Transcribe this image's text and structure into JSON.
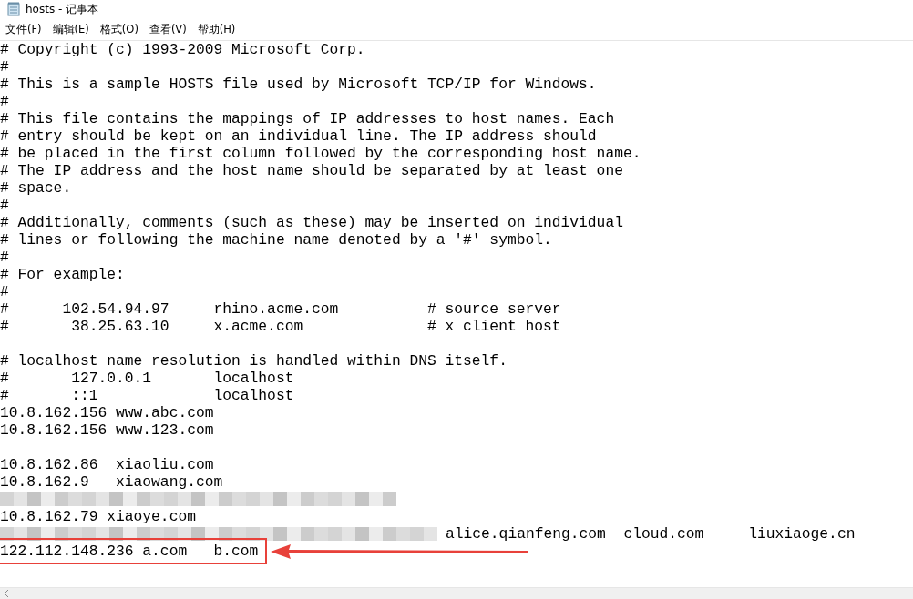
{
  "window": {
    "title": "hosts - 记事本"
  },
  "menu": [
    "文件(F)",
    "编辑(E)",
    "格式(O)",
    "查看(V)",
    "帮助(H)"
  ],
  "lines": [
    {
      "kind": "text",
      "text": "# Copyright (c) 1993-2009 Microsoft Corp."
    },
    {
      "kind": "text",
      "text": "#"
    },
    {
      "kind": "text",
      "text": "# This is a sample HOSTS file used by Microsoft TCP/IP for Windows."
    },
    {
      "kind": "text",
      "text": "#"
    },
    {
      "kind": "text",
      "text": "# This file contains the mappings of IP addresses to host names. Each"
    },
    {
      "kind": "text",
      "text": "# entry should be kept on an individual line. The IP address should"
    },
    {
      "kind": "text",
      "text": "# be placed in the first column followed by the corresponding host name."
    },
    {
      "kind": "text",
      "text": "# The IP address and the host name should be separated by at least one"
    },
    {
      "kind": "text",
      "text": "# space."
    },
    {
      "kind": "text",
      "text": "#"
    },
    {
      "kind": "text",
      "text": "# Additionally, comments (such as these) may be inserted on individual"
    },
    {
      "kind": "text",
      "text": "# lines or following the machine name denoted by a '#' symbol."
    },
    {
      "kind": "text",
      "text": "#"
    },
    {
      "kind": "text",
      "text": "# For example:"
    },
    {
      "kind": "text",
      "text": "#"
    },
    {
      "kind": "text",
      "text": "#      102.54.94.97     rhino.acme.com          # source server"
    },
    {
      "kind": "text",
      "text": "#       38.25.63.10     x.acme.com              # x client host"
    },
    {
      "kind": "blank"
    },
    {
      "kind": "text",
      "text": "# localhost name resolution is handled within DNS itself."
    },
    {
      "kind": "text",
      "text": "#       127.0.0.1       localhost"
    },
    {
      "kind": "text",
      "text": "#       ::1             localhost"
    },
    {
      "kind": "text",
      "text": "10.8.162.156 www.abc.com"
    },
    {
      "kind": "text",
      "text": "10.8.162.156 www.123.com"
    },
    {
      "kind": "blank"
    },
    {
      "kind": "text",
      "text": "10.8.162.86  xiaoliu.com"
    },
    {
      "kind": "text",
      "text": "10.8.162.9   xiaowang.com"
    },
    {
      "kind": "redacted"
    },
    {
      "kind": "text",
      "text": "10.8.162.79 xiaoye.com"
    },
    {
      "kind": "redacted",
      "text": "alice.qianfeng.com  cloud.com     liuxiaoge.cn"
    },
    {
      "kind": "text",
      "text": "122.112.148.236 a.com   b.com",
      "highlighted": true
    }
  ]
}
